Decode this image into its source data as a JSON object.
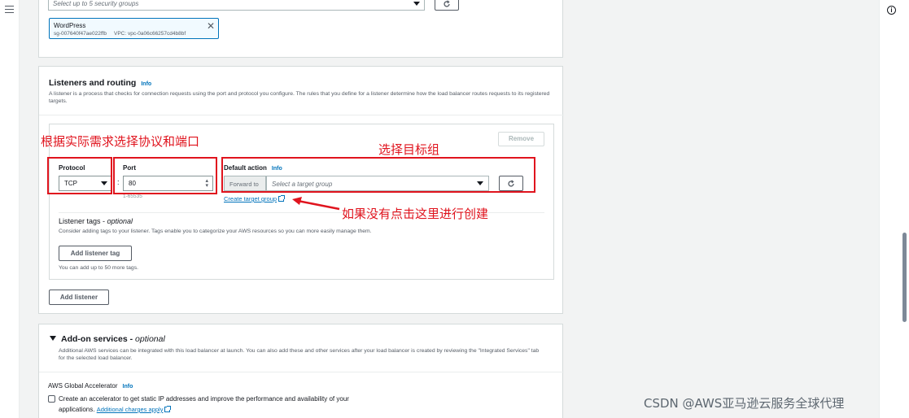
{
  "security_groups": {
    "placeholder": "Select up to 5 security groups",
    "token": {
      "name": "WordPress",
      "id": "sg-007640f47ae022ffb",
      "vpc": "VPC: vpc-0a06c66257cd4b8bf"
    }
  },
  "listeners": {
    "title": "Listeners and routing",
    "info": "Info",
    "description": "A listener is a process that checks for connection requests using the port and protocol you configure. The rules that you define for a listener determine how the load balancer routes requests to its registered targets.",
    "remove_label": "Remove",
    "protocol_label": "Protocol",
    "protocol_value": "TCP",
    "port_label": "Port",
    "port_value": "80",
    "port_hint": "1-65535",
    "default_action_label": "Default action",
    "default_action_info": "Info",
    "forward_to": "Forward to",
    "target_group_placeholder": "Select a target group",
    "create_target_group": "Create target group",
    "listener_tags_title": "Listener tags - ",
    "listener_tags_optional": "optional",
    "listener_tags_desc": "Consider adding tags to your listener. Tags enable you to categorize your AWS resources so you can more easily manage them.",
    "add_listener_tag": "Add listener tag",
    "tag_limit": "You can add up to 50 more tags.",
    "add_listener": "Add listener"
  },
  "addon": {
    "title": "Add-on services - ",
    "optional": "optional",
    "description": "Additional AWS services can be integrated with this load balancer at launch. You can also add these and other services after your load balancer is created by reviewing the \"Integrated Services\" tab for the selected load balancer.",
    "accelerator_title": "AWS Global Accelerator",
    "accelerator_info": "Info",
    "accelerator_checkbox_text": "Create an accelerator to get static IP addresses and improve the performance and availability of your",
    "accelerator_checkbox_text2": "applications.",
    "additional_charges": "Additional charges apply"
  },
  "annotations": {
    "protocol_port": "根据实际需求选择协议和端口",
    "target_group": "选择目标组",
    "create_hint": "如果没有点击这里进行创建",
    "color": "#e0141e"
  },
  "watermark": "CSDN @AWS亚马逊云服务全球代理"
}
